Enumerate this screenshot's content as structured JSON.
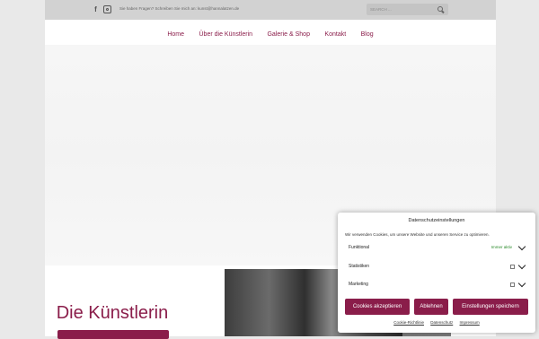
{
  "topbar": {
    "facebook_icon": "facebook-icon",
    "instagram_icon": "instagram-icon",
    "hint": "Sie haben Fragen? Schreiben Sie mich an: kunst@hannalatzen.de",
    "search_placeholder": "SEARCH ...",
    "search_icon": "search-icon"
  },
  "nav": {
    "items": [
      "Home",
      "Über die Künstlerin",
      "Galerie & Shop",
      "Kontakt",
      "Blog"
    ]
  },
  "main": {
    "artist_title": "Die Künstlerin"
  },
  "consent": {
    "title": "Datenschutzeinstellungen",
    "description": "Wir verwenden Cookies, um unsere Website und unseren Service zu optimieren.",
    "rows": [
      {
        "label": "Funktional",
        "status": "Immer aktiv"
      },
      {
        "label": "Statistiken"
      },
      {
        "label": "Marketing"
      }
    ],
    "buttons": {
      "accept": "Cookies akzeptieren",
      "reject": "Ablehnen",
      "settings": "Einstellungen speichern"
    },
    "links": [
      "Cookie-Richtlinie",
      "Datenschutz",
      "Impressum"
    ]
  },
  "colors": {
    "accent": "#8a1d4a",
    "active_green": "#2a8a2a"
  }
}
